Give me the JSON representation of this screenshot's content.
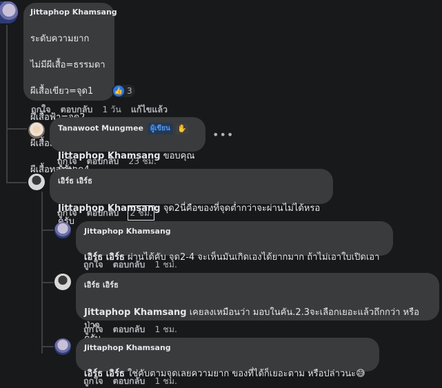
{
  "comments": [
    {
      "author": "Jittaphop Khamsang",
      "lines": [
        "ระดับความยาก",
        "ไม่มีผีเสื้อ=ธรรมดา",
        "ผีเสื้อเขียว=จุด1",
        "ผีเสื้อฟ้า=จุด2",
        "ผีเสื้อม่วง=จุด3",
        "ผีเสื้อทอง=จุด4"
      ],
      "reaction_count": "3",
      "like": "ถูกใจ",
      "reply": "ตอบกลับ",
      "time": "1 วัน",
      "edited": "แก้ไขแล้ว"
    },
    {
      "author": "Tanawoot Mungmee",
      "badge": "ผู้เขียน",
      "mention": "Jittaphop Khamsang",
      "text": "ขอบคุณครับ",
      "like": "ถูกใจ",
      "reply": "ตอบกลับ",
      "time": "23 ชม."
    },
    {
      "author": "เอิร์ธ เอิร์ธ",
      "mention": "Jittaphop Khamsang",
      "text": "จุด2นี่คือของที่จุดต่ำกว่าจะผ่านไม่ได้หรอครับ",
      "like": "ถูกใจ",
      "reply": "ตอบกลับ",
      "time": "2 ชม."
    },
    {
      "author": "Jittaphop Khamsang",
      "mention": "เอิร์ธ เอิร์ธ",
      "text": "ผ่านได้คับ จุด2-4 จะเห็นมันเกิดเองได้ยากมาก ถ้าไม่เอาใบเปิดเอา",
      "like": "ถูกใจ",
      "reply": "ตอบกลับ",
      "time": "1 ชม."
    },
    {
      "author": "เอิร์ธ เอิร์ธ",
      "mention": "Jittaphop Khamsang",
      "text": "เคยลงเหมือนว่า มอบในคัน.2.3จะเลือกเยอะแล้วถึกกว่า หรือป่าว",
      "text2": "ครับ",
      "like": "ถูกใจ",
      "reply": "ตอบกลับ",
      "time": "1 ชม."
    },
    {
      "author": "Jittaphop Khamsang",
      "mention": "เอิร์ธ เอิร์ธ",
      "text": "ใช่คับตามจุดเลยความยาก ของที่ได้ก็เยอะตาม หรือปล่าวนะ",
      "emoji": "😅",
      "like": "ถูกใจ",
      "reply": "ตอบกลับ",
      "time": "1 ชม."
    }
  ],
  "more_icon": "ellipsis-icon",
  "like_icon": "thumbs-up-icon",
  "wave_icon": "wave-hand-icon"
}
